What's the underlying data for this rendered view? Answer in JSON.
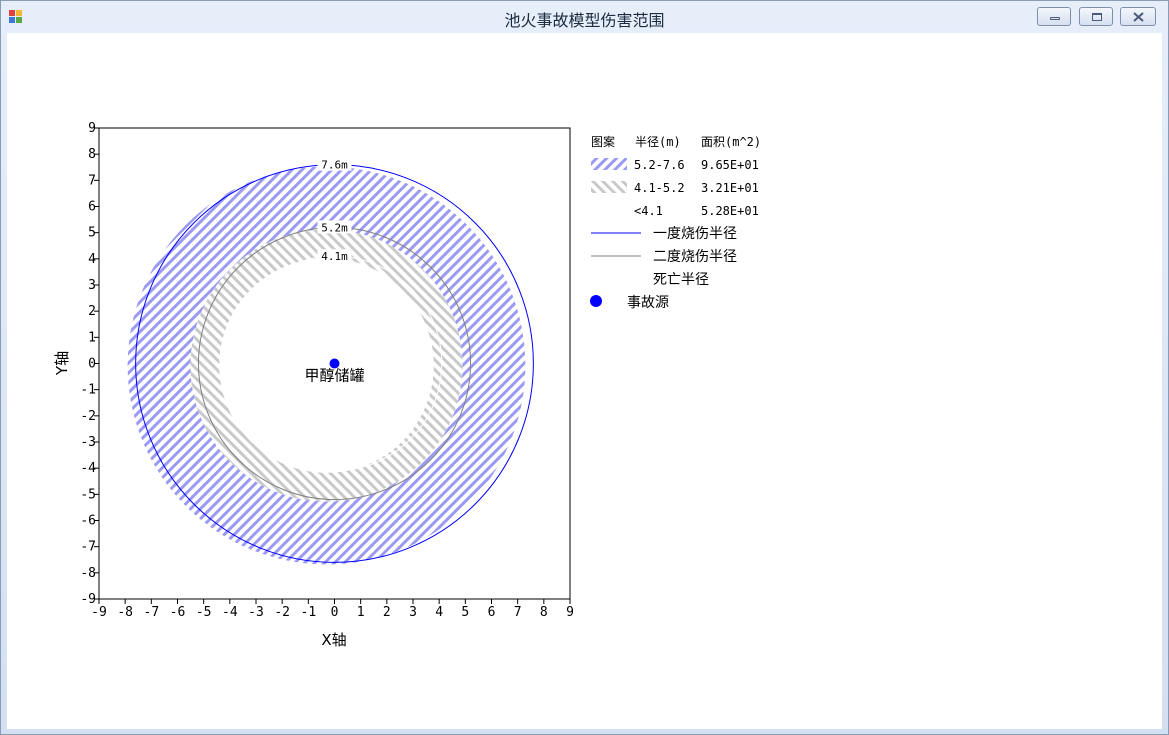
{
  "window": {
    "title": "池火事故模型伤害范围",
    "controls": [
      "minimize",
      "maximize",
      "close"
    ]
  },
  "chart_data": {
    "type": "circles",
    "xlabel": "X轴",
    "ylabel": "Y轴",
    "xlim": [
      -9,
      9
    ],
    "ylim": [
      -9,
      9
    ],
    "ticks": [
      -9,
      -8,
      -7,
      -6,
      -5,
      -4,
      -3,
      -2,
      -1,
      0,
      1,
      2,
      3,
      4,
      5,
      6,
      7,
      8,
      9
    ],
    "source": {
      "x": 0,
      "y": 0,
      "label": "甲醇储罐",
      "color": "#0000ff"
    },
    "circles": [
      {
        "name": "一度烧伤半径",
        "radius": 7.6,
        "label": "7.6m",
        "color": "#0000ff"
      },
      {
        "name": "二度烧伤半径",
        "radius": 5.2,
        "label": "5.2m",
        "color": "#808080"
      },
      {
        "name": "死亡半径",
        "radius": 4.1,
        "label": "4.1m",
        "color": "#ffffff"
      }
    ],
    "zones": [
      {
        "range": "5.2-7.6",
        "area": "9.65E+01",
        "hatch_color": "#9a9af5"
      },
      {
        "range": "4.1-5.2",
        "area": "3.21E+01",
        "hatch_color": "#c9c9c9"
      },
      {
        "range": "<4.1",
        "area": "5.28E+01",
        "hatch_color": "none"
      }
    ],
    "legend": {
      "header": {
        "pattern": "图案",
        "radius": "半径(m)",
        "area": "面积(m^2)"
      },
      "items": [
        {
          "label": "一度烧伤半径",
          "style": "line",
          "color": "#0000ff"
        },
        {
          "label": "二度烧伤半径",
          "style": "line",
          "color": "#808080"
        },
        {
          "label": "死亡半径",
          "style": "none",
          "color": "#ffffff"
        },
        {
          "label": "事故源",
          "style": "dot",
          "color": "#0000ff"
        }
      ]
    }
  }
}
